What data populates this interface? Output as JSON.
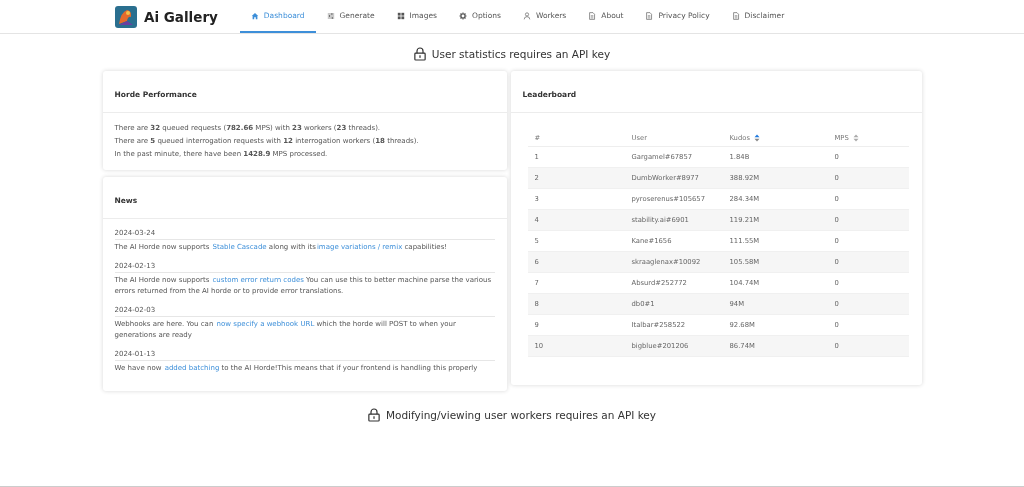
{
  "brand": {
    "name": "Ai Gallery"
  },
  "nav": [
    {
      "label": "Dashboard",
      "selected": true
    },
    {
      "label": "Generate",
      "selected": false
    },
    {
      "label": "Images",
      "selected": false
    },
    {
      "label": "Options",
      "selected": false
    },
    {
      "label": "Workers",
      "selected": false
    },
    {
      "label": "About",
      "selected": false
    },
    {
      "label": "Privacy Policy",
      "selected": false
    },
    {
      "label": "Disclaimer",
      "selected": false
    }
  ],
  "notice_top": "User statistics requires an API key",
  "performance": {
    "title": "Horde Performance",
    "lines": [
      "There are **32** queued requests (**782.66** MPS) with **23** workers (**23** threads).",
      "There are **5** queued interrogation requests with **12** interrogation workers (**18** threads).",
      "In the past minute, there have been **1428.9** MPS processed."
    ]
  },
  "news": {
    "title": "News",
    "items": [
      {
        "date": "2024-03-24",
        "parts": [
          {
            "kind": "text",
            "text": "The AI Horde now supports "
          },
          {
            "kind": "link",
            "text": "Stable Cascade"
          },
          {
            "kind": "text",
            "text": " along with its"
          },
          {
            "kind": "link",
            "text": "image variations / remix"
          },
          {
            "kind": "text",
            "text": " capabilities!"
          }
        ]
      },
      {
        "date": "2024-02-13",
        "parts": [
          {
            "kind": "text",
            "text": "The AI Horde now supports "
          },
          {
            "kind": "link",
            "text": "custom error return codes"
          },
          {
            "kind": "text",
            "text": " You can use this to better machine parse the various errors returned from the AI horde or to provide error translations."
          }
        ]
      },
      {
        "date": "2024-02-03",
        "parts": [
          {
            "kind": "text",
            "text": "Webhooks are here. You can "
          },
          {
            "kind": "link",
            "text": "now specify a webhook URL"
          },
          {
            "kind": "text",
            "text": " which the horde will POST to when your generations are ready"
          }
        ]
      },
      {
        "date": "2024-01-13",
        "parts": [
          {
            "kind": "text",
            "text": "We have now "
          },
          {
            "kind": "link",
            "text": "added batching"
          },
          {
            "kind": "text",
            "text": " to the AI Horde!This means that if your frontend is handling this properly"
          }
        ]
      }
    ]
  },
  "leaderboard": {
    "title": "Leaderboard",
    "columns": [
      {
        "label": "#",
        "kind": "plain"
      },
      {
        "label": "User",
        "kind": "plain"
      },
      {
        "label": "Kudos",
        "kind": "sortable",
        "sorted": true
      },
      {
        "label": "MPS",
        "kind": "sortable",
        "sorted": false
      }
    ],
    "rows": [
      [
        "1",
        "Gargamel#67857",
        "1.84B",
        "0"
      ],
      [
        "2",
        "DumbWorker#8977",
        "388.92M",
        "0"
      ],
      [
        "3",
        "pyroserenus#105657",
        "284.34M",
        "0"
      ],
      [
        "4",
        "stability.ai#6901",
        "119.21M",
        "0"
      ],
      [
        "5",
        "Kane#1656",
        "111.55M",
        "0"
      ],
      [
        "6",
        "skraaglenax#10092",
        "105.58M",
        "0"
      ],
      [
        "7",
        "Absurd#252772",
        "104.74M",
        "0"
      ],
      [
        "8",
        "db0#1",
        "94M",
        "0"
      ],
      [
        "9",
        "Italbar#258522",
        "92.68M",
        "0"
      ],
      [
        "10",
        "bigblue#201206",
        "86.74M",
        "0"
      ]
    ]
  },
  "notice_bottom": "Modifying/viewing user workers requires an API key"
}
